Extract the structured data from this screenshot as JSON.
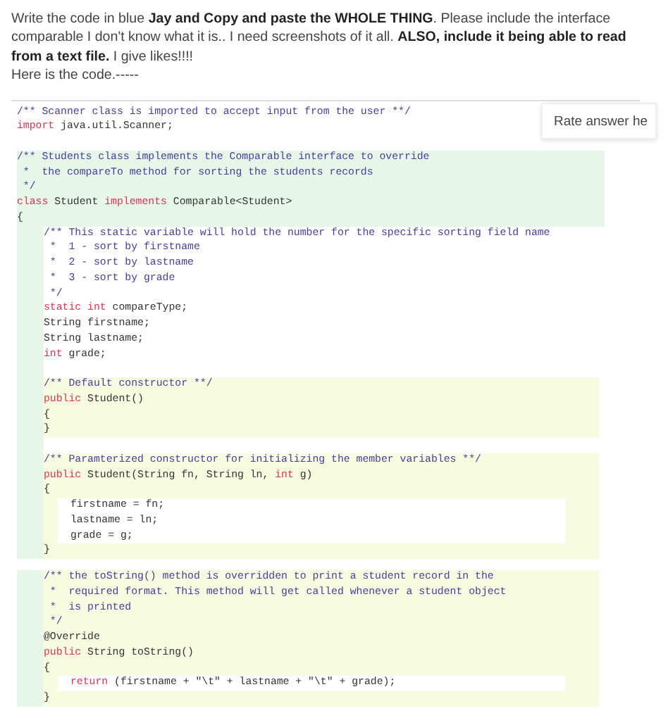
{
  "question": {
    "paragraph": "Write the code in blue **Jay and Copy and paste the WHOLE THING**. Please include the interface comparable I don't know what it is.. I need screenshots of it all. **ALSO, include it being able to read from a text file.** I give likes!!!!",
    "note": "Here is the code.-----"
  },
  "rate_panel": {
    "label": "Rate answer he"
  },
  "code": {
    "blocks": [
      {
        "kind": "plain",
        "lines": [
          {
            "tokens": [
              {
                "kind": "comment",
                "text": "/** Scanner class is imported to accept input from the user **/"
              }
            ]
          },
          {
            "tokens": [
              {
                "kind": "keyword",
                "text": "import"
              },
              {
                "kind": "plain",
                "text": " java.util.Scanner;"
              }
            ]
          }
        ]
      },
      {
        "kind": "class",
        "lines": [
          {
            "tokens": [
              {
                "kind": "comment",
                "text": "/** Students class implements the Comparable interface to override"
              }
            ]
          },
          {
            "tokens": [
              {
                "kind": "comment",
                "text": " *  the compareTo method for sorting the students records"
              }
            ]
          },
          {
            "tokens": [
              {
                "kind": "comment",
                "text": " */"
              }
            ]
          },
          {
            "tokens": [
              {
                "kind": "keyword",
                "text": "class"
              },
              {
                "kind": "plain",
                "text": " Student "
              },
              {
                "kind": "keyword",
                "text": "implements"
              },
              {
                "kind": "plain",
                "text": " Comparable<Student>"
              }
            ]
          },
          {
            "tokens": [
              {
                "kind": "plain",
                "text": "{"
              }
            ]
          }
        ]
      },
      {
        "kind": "gutter",
        "blocks": [
          {
            "kind": "plain",
            "lines": [
              {
                "tokens": [
                  {
                    "kind": "comment",
                    "text": "/** This static variable will hold the number for the specific sorting field name"
                  }
                ]
              },
              {
                "tokens": [
                  {
                    "kind": "comment",
                    "text": " *  1 - sort by firstname"
                  }
                ]
              },
              {
                "tokens": [
                  {
                    "kind": "comment",
                    "text": " *  2 - sort by lastname"
                  }
                ]
              },
              {
                "tokens": [
                  {
                    "kind": "comment",
                    "text": " *  3 - sort by grade"
                  }
                ]
              },
              {
                "tokens": [
                  {
                    "kind": "comment",
                    "text": " */"
                  }
                ]
              },
              {
                "tokens": [
                  {
                    "kind": "keyword",
                    "text": "static int"
                  },
                  {
                    "kind": "plain",
                    "text": " compareType;"
                  }
                ]
              },
              {
                "tokens": [
                  {
                    "kind": "plain",
                    "text": "String firstname;"
                  }
                ]
              },
              {
                "tokens": [
                  {
                    "kind": "plain",
                    "text": "String lastname;"
                  }
                ]
              },
              {
                "tokens": [
                  {
                    "kind": "keyword",
                    "text": "int"
                  },
                  {
                    "kind": "plain",
                    "text": " grade;"
                  }
                ]
              }
            ]
          },
          {
            "kind": "member",
            "lines": [
              {
                "tokens": [
                  {
                    "kind": "comment",
                    "text": "/** Default constructor **/"
                  }
                ]
              },
              {
                "tokens": [
                  {
                    "kind": "keyword",
                    "text": "public"
                  },
                  {
                    "kind": "plain",
                    "text": " Student()"
                  }
                ]
              },
              {
                "tokens": [
                  {
                    "kind": "plain",
                    "text": "{"
                  }
                ]
              },
              {
                "tokens": [
                  {
                    "kind": "plain",
                    "text": "}"
                  }
                ]
              }
            ]
          },
          {
            "kind": "member",
            "lines": [
              {
                "tokens": [
                  {
                    "kind": "comment",
                    "text": "/** Paramterized constructor for initializing the member variables **/"
                  }
                ]
              },
              {
                "tokens": [
                  {
                    "kind": "keyword",
                    "text": "public"
                  },
                  {
                    "kind": "plain",
                    "text": " Student(String fn, String ln, "
                  },
                  {
                    "kind": "keyword",
                    "text": "int"
                  },
                  {
                    "kind": "plain",
                    "text": " g)"
                  }
                ]
              },
              {
                "tokens": [
                  {
                    "kind": "plain",
                    "text": "{"
                  }
                ]
              },
              {
                "kind": "body",
                "tokens": [
                  {
                    "kind": "plain",
                    "text": "firstname = fn;"
                  }
                ]
              },
              {
                "kind": "body",
                "tokens": [
                  {
                    "kind": "plain",
                    "text": "lastname = ln;"
                  }
                ]
              },
              {
                "kind": "body",
                "tokens": [
                  {
                    "kind": "plain",
                    "text": "grade = g;"
                  }
                ]
              },
              {
                "tokens": [
                  {
                    "kind": "plain",
                    "text": "}"
                  }
                ]
              }
            ]
          }
        ]
      },
      {
        "kind": "gutter",
        "blocks": [
          {
            "kind": "member",
            "lines": [
              {
                "tokens": [
                  {
                    "kind": "comment",
                    "text": "/** the toString() method is overridden to print a student record in the"
                  }
                ]
              },
              {
                "tokens": [
                  {
                    "kind": "comment",
                    "text": " *  required format. This method will get called whenever a student object"
                  }
                ]
              },
              {
                "tokens": [
                  {
                    "kind": "comment",
                    "text": " *  is printed"
                  }
                ]
              },
              {
                "tokens": [
                  {
                    "kind": "comment",
                    "text": " */"
                  }
                ]
              },
              {
                "tokens": [
                  {
                    "kind": "plain",
                    "text": "@Override"
                  }
                ]
              },
              {
                "tokens": [
                  {
                    "kind": "keyword",
                    "text": "public"
                  },
                  {
                    "kind": "plain",
                    "text": " String toString()"
                  }
                ]
              },
              {
                "tokens": [
                  {
                    "kind": "plain",
                    "text": "{"
                  }
                ]
              },
              {
                "kind": "body",
                "tokens": [
                  {
                    "kind": "keyword",
                    "text": "return"
                  },
                  {
                    "kind": "plain",
                    "text": " (firstname + \"\\t\" + lastname + \"\\t\" + grade);"
                  }
                ]
              },
              {
                "tokens": [
                  {
                    "kind": "plain",
                    "text": "}"
                  }
                ]
              }
            ]
          }
        ]
      }
    ]
  }
}
